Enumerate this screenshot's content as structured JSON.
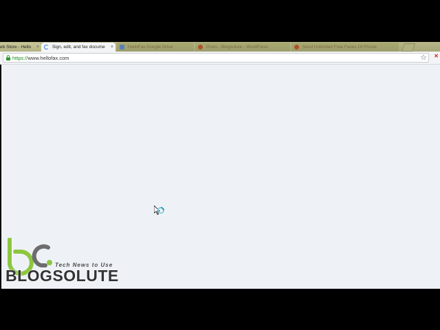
{
  "browser": {
    "tabs": [
      {
        "label": "eb Store - Hello",
        "state": "inactive"
      },
      {
        "label": "Sign, edit, and fax docume",
        "state": "active"
      },
      {
        "label": "HelloFax Google Drive",
        "state": "faded"
      },
      {
        "label": "Posts - Blogsolute - WordPress",
        "state": "faded"
      },
      {
        "label": "Send Unlimited Free Faxes Of Phone",
        "state": "faded"
      }
    ],
    "close_glyph": "×",
    "address": {
      "scheme": "https://",
      "host": "www.hellofax.com"
    },
    "star_glyph": "☆",
    "extension_glyph": "✕"
  },
  "watermark": {
    "tagline": "Tech News to Use",
    "brand": "BLOGSOLUTE",
    "colors": {
      "green": "#8cc63f",
      "grey": "#6d6d6d"
    }
  }
}
